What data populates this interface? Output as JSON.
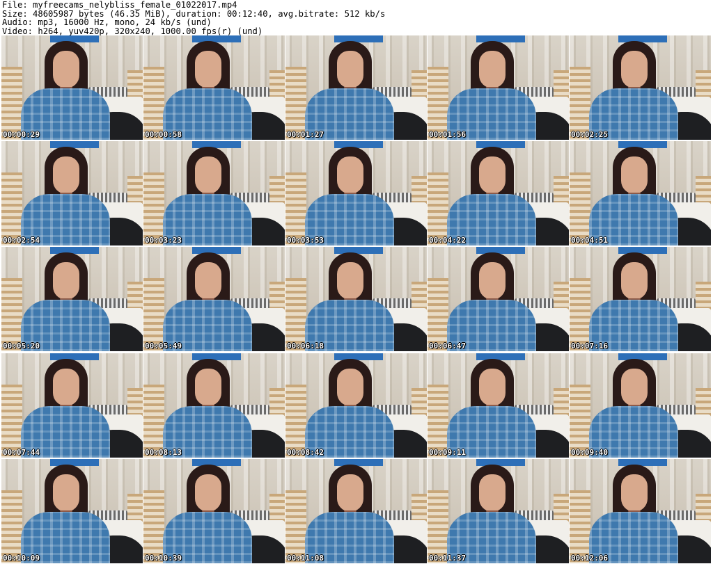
{
  "header": {
    "file": "File: myfreecams_nelybliss_female_01022017.mp4",
    "size": "Size: 48605987 bytes (46.35 MiB), duration: 00:12:40, avg.bitrate: 512 kb/s",
    "audio": "Audio: mp3, 16000 Hz, mono, 24 kb/s (und)",
    "video": "Video: h264, yuv420p, 320x240, 1000.00 fps(r) (und)"
  },
  "timestamps": [
    "00:00:29",
    "00:00:58",
    "00:01:27",
    "00:01:56",
    "00:02:25",
    "00:02:54",
    "00:03:23",
    "00:03:53",
    "00:04:22",
    "00:04:51",
    "00:05:20",
    "00:05:49",
    "00:06:18",
    "00:06:47",
    "00:07:16",
    "00:07:44",
    "00:08:13",
    "00:08:42",
    "00:09:11",
    "00:09:40",
    "00:10:09",
    "00:10:39",
    "00:11:08",
    "00:11:37",
    "00:12:06"
  ]
}
